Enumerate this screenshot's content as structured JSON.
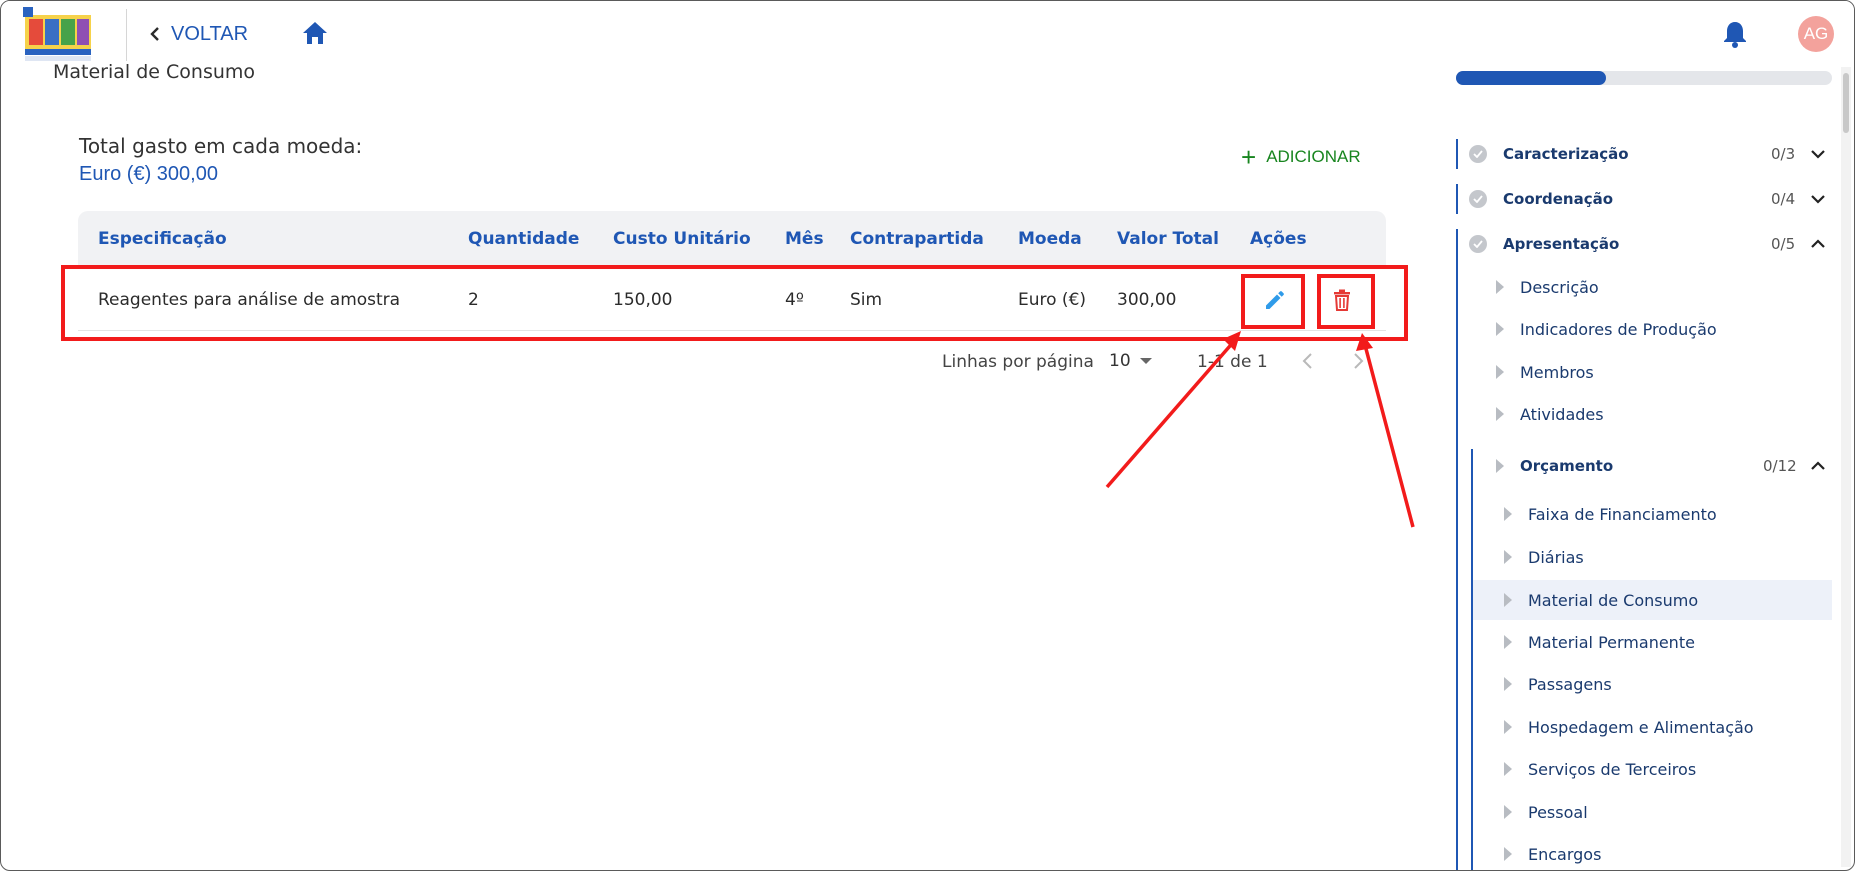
{
  "header": {
    "back_label": "VOLTAR",
    "avatar_initials": "AG",
    "logo_alt": "EDES Engenharia de Software"
  },
  "page": {
    "section_title": "Material de Consumo",
    "totals_label": "Total gasto em cada moeda:",
    "totals_value": "Euro (€) 300,00",
    "add_label": "ADICIONAR"
  },
  "table": {
    "headers": [
      "Especificação",
      "Quantidade",
      "Custo Unitário",
      "Mês",
      "Contrapartida",
      "Moeda",
      "Valor Total",
      "Ações"
    ],
    "rows": [
      [
        "Reagentes para análise de amostra",
        "2",
        "150,00",
        "4º",
        "Sim",
        "Euro (€)",
        "300,00"
      ]
    ]
  },
  "pagination": {
    "rows_per_page_label": "Linhas por página",
    "rows_per_page_value": "10",
    "range_text": "1-1 de 1"
  },
  "sidebar": {
    "progress_fraction": 0.4,
    "sections": [
      {
        "label": "Caracterização",
        "count": "0/3",
        "expanded": false
      },
      {
        "label": "Coordenação",
        "count": "0/4",
        "expanded": false
      },
      {
        "label": "Apresentação",
        "count": "0/5",
        "expanded": true
      }
    ],
    "apresentacao_items": [
      "Descrição",
      "Indicadores de Produção",
      "Membros",
      "Atividades"
    ],
    "orcamento": {
      "label": "Orçamento",
      "count": "0/12",
      "items": [
        "Faixa de Financiamento",
        "Diárias",
        "Material de Consumo",
        "Material Permanente",
        "Passagens",
        "Hospedagem e Alimentação",
        "Serviços de Terceiros",
        "Pessoal",
        "Encargos"
      ],
      "active_item": "Material de Consumo"
    }
  },
  "colors": {
    "primary": "#1f57b4",
    "add_green": "#18851f",
    "edit_blue": "#2f9be9",
    "delete_red": "#e53935",
    "annotation_red": "#f21b1b"
  }
}
